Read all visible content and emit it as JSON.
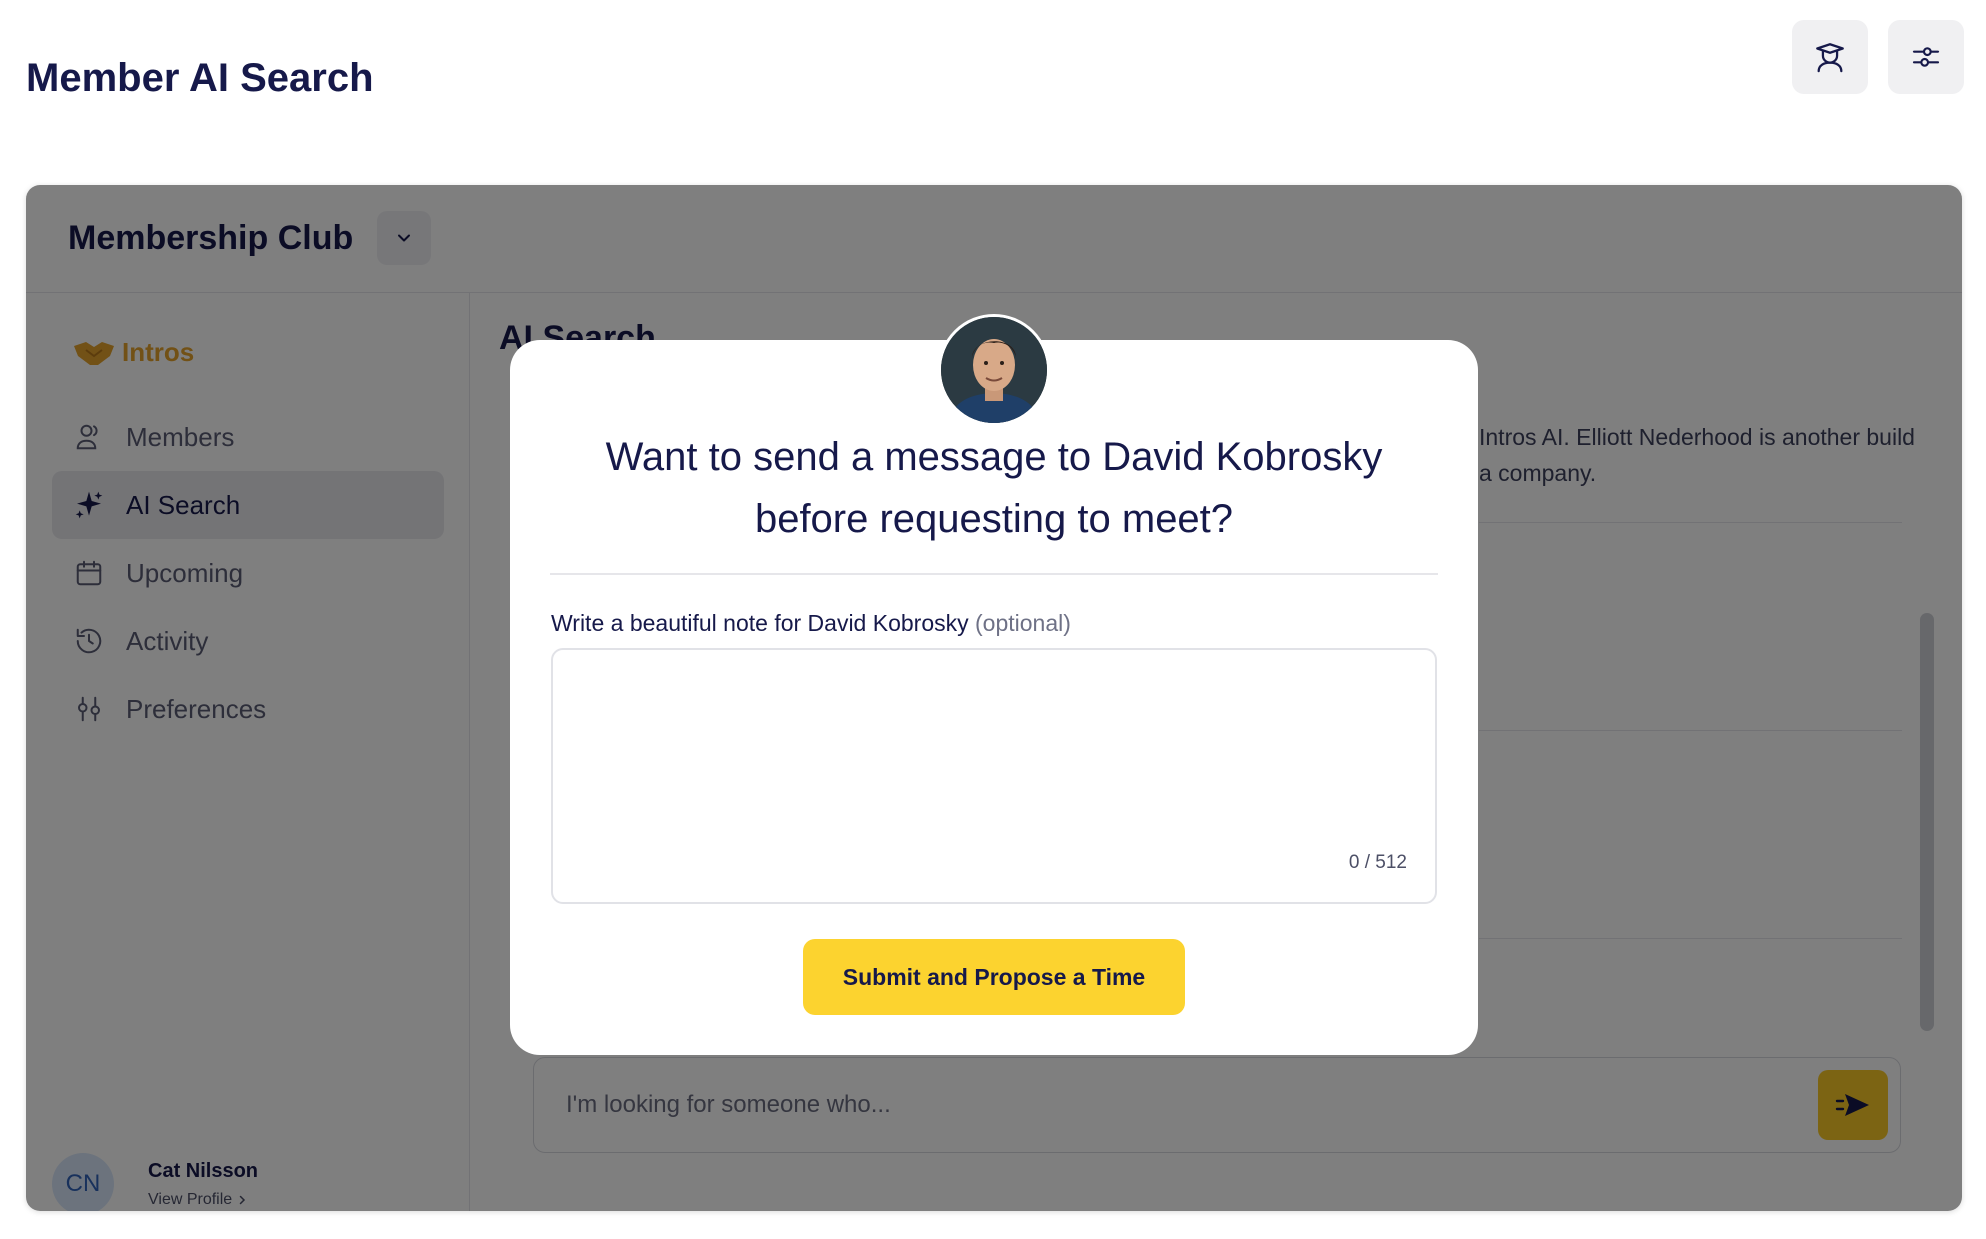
{
  "page": {
    "title": "Member AI Search"
  },
  "top_actions": [
    {
      "icon": "graduation-person-icon"
    },
    {
      "icon": "sliders-icon"
    }
  ],
  "app": {
    "club_name": "Membership Club",
    "brand": "Intros",
    "nav": [
      {
        "label": "Members",
        "icon": "users-icon",
        "active": false
      },
      {
        "label": "AI Search",
        "icon": "sparkle-icon",
        "active": true
      },
      {
        "label": "Upcoming",
        "icon": "calendar-icon",
        "active": false
      },
      {
        "label": "Activity",
        "icon": "history-icon",
        "active": false
      },
      {
        "label": "Preferences",
        "icon": "preferences-icon",
        "active": false
      }
    ],
    "user": {
      "initials": "CN",
      "name": "Cat Nilsson",
      "view_profile": "View Profile"
    },
    "main": {
      "title": "AI Search",
      "result_text": "Intros AI. Elliott Nederhood is another build a company.",
      "search_placeholder": "I'm looking for someone who..."
    }
  },
  "modal": {
    "title": "Want to send a message to David Kobrosky before requesting to meet?",
    "note_label": "Write a beautiful note for David Kobrosky",
    "note_optional": "(optional)",
    "note_value": "",
    "char_count": "0 / 512",
    "submit_label": "Submit and Propose a Time"
  },
  "colors": {
    "accent": "#fcd32f",
    "brand": "#e5a32c",
    "text": "#16194a"
  }
}
